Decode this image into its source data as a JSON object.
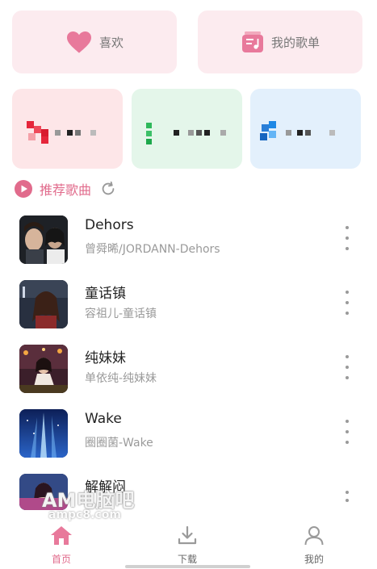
{
  "quick_cards": {
    "favorites_label": "喜欢",
    "playlist_label": "我的歌单"
  },
  "recommend": {
    "title": "推荐歌曲"
  },
  "songs": [
    {
      "title": "Dehors",
      "subtitle": "曾舜晞/JORDANN-Dehors"
    },
    {
      "title": "童话镇",
      "subtitle": "容祖儿-童话镇"
    },
    {
      "title": "纯妹妹",
      "subtitle": "单依纯-纯妹妹"
    },
    {
      "title": "Wake",
      "subtitle": "圈圈菌-Wake"
    },
    {
      "title": "解解闷",
      "subtitle": ""
    }
  ],
  "watermark": {
    "line1": "AM电脑吧",
    "line2": "ampc8.com"
  },
  "nav": {
    "home_label": "首页",
    "download_label": "下载",
    "mine_label": "我的"
  },
  "colors": {
    "accent": "#e16b8c",
    "card_pink": "#fcebef",
    "tile_pink": "#fde6e8",
    "tile_green": "#e4f6ea",
    "tile_blue": "#e3f0fc"
  }
}
